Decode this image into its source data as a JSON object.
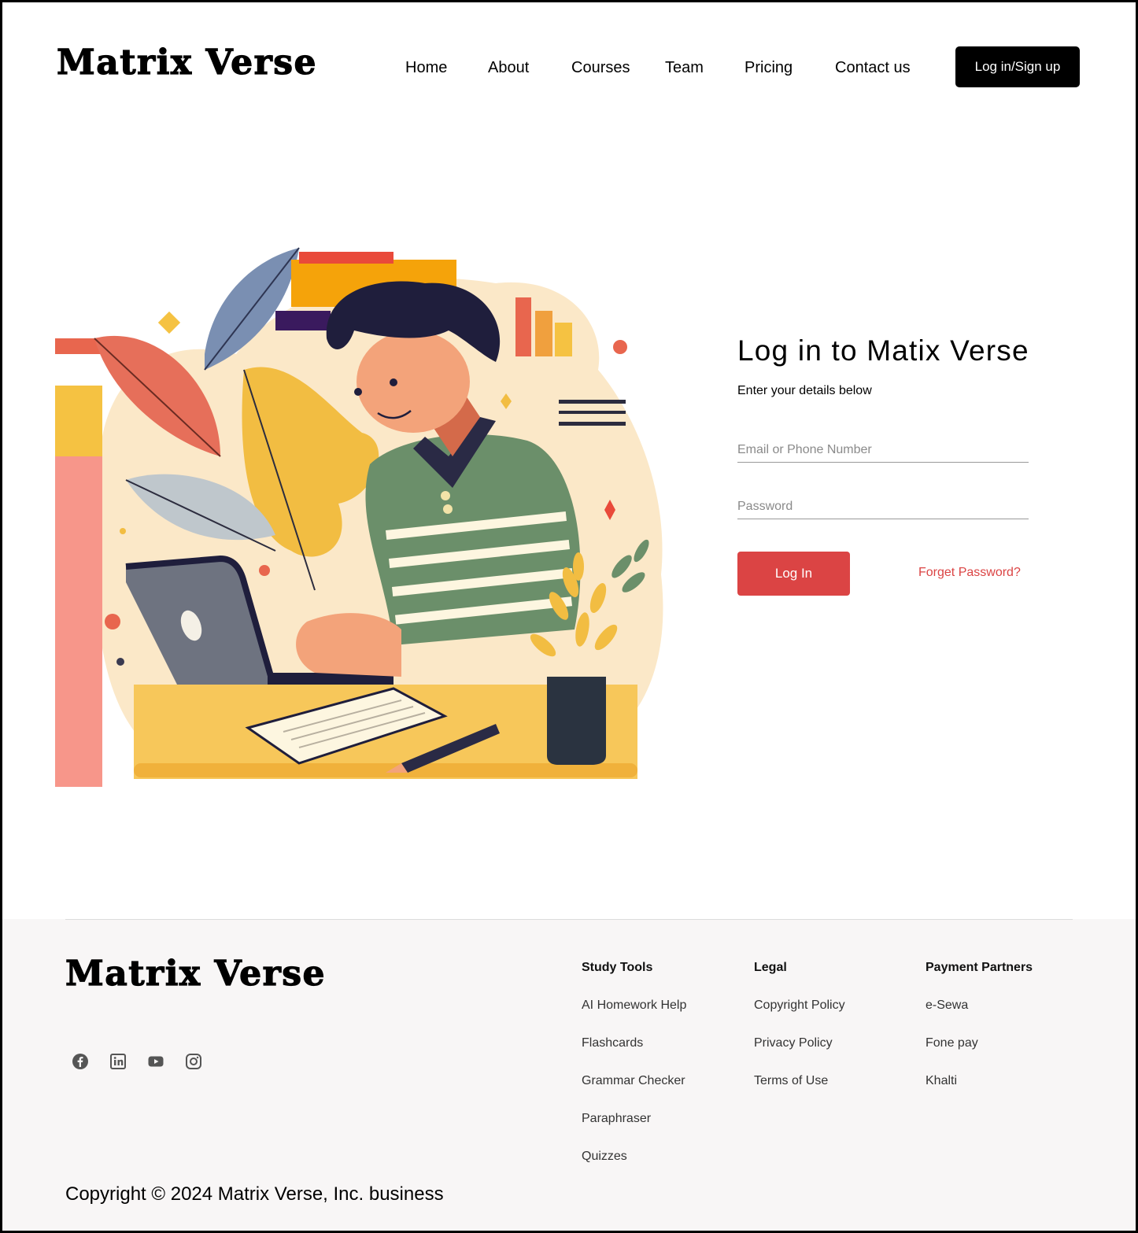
{
  "brand": {
    "name": "Matrix Verse"
  },
  "nav": {
    "items": [
      "Home",
      "About",
      "Courses",
      "Team",
      "Pricing",
      "Contact us"
    ],
    "cta_label": "Log in/Sign up"
  },
  "login": {
    "title": "Log in to Matix Verse",
    "subtitle": "Enter your details below",
    "email_placeholder": "Email or Phone Number",
    "password_placeholder": "Password",
    "submit_label": "Log In",
    "forgot_label": "Forget Password?"
  },
  "footer": {
    "brand": "Matrix Verse",
    "socials": [
      "facebook-icon",
      "linkedin-icon",
      "youtube-icon",
      "instagram-icon"
    ],
    "columns": [
      {
        "title": "Study Tools",
        "links": [
          "AI Homework Help",
          "Flashcards",
          "Grammar Checker",
          "Paraphraser",
          "Quizzes"
        ]
      },
      {
        "title": "Legal",
        "links": [
          "Copyright Policy",
          "Privacy Policy",
          "Terms of Use"
        ]
      },
      {
        "title": "Payment Partners",
        "links": [
          "e-Sewa",
          "Fone pay",
          "Khalti"
        ]
      }
    ],
    "copyright": "Copyright © 2024 Matrix Verse, Inc. business"
  },
  "colors": {
    "accent": "#DB4444",
    "primary_button": "#000000",
    "footer_bg": "#F8F6F6"
  }
}
